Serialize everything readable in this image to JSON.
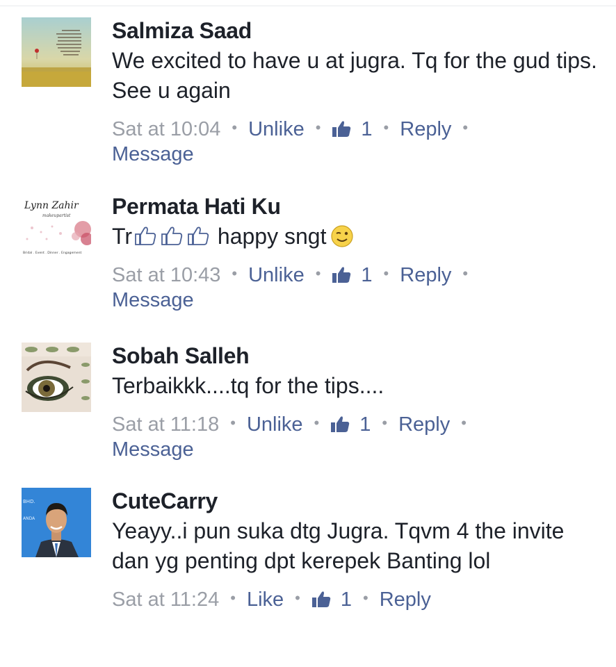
{
  "comments": [
    {
      "name": "Salmiza Saad",
      "text": "We excited to have u at jugra. Tq for the gud tips. See u again",
      "time": "Sat at 10:04",
      "like_action": "Unlike",
      "like_count": "1",
      "reply": "Reply",
      "message": "Message",
      "avatar_text": "...Kalau kita BERUBAH untuk jadi baik kerana Allah, Allah akan hantar orang-orang yang baik untuk bersama sama kita..."
    },
    {
      "name": "Permata Hati Ku",
      "text_prefix": "Tr",
      "text_suffix": "happy sngt",
      "time": "Sat at 10:43",
      "like_action": "Unlike",
      "like_count": "1",
      "reply": "Reply",
      "message": "Message",
      "avatar_title": "Lynn Zahir",
      "avatar_sub": "makeupartist",
      "avatar_caption": "Bridal . Event . Dinner . Engagement"
    },
    {
      "name": "Sobah Salleh",
      "text": "Terbaikkk....tq for the tips....",
      "time": "Sat at 11:18",
      "like_action": "Unlike",
      "like_count": "1",
      "reply": "Reply",
      "message": "Message"
    },
    {
      "name": "CuteCarry",
      "text": "Yeayy..i pun suka dtg Jugra. Tqvm 4 the invite dan yg penting dpt kerepek Banting lol",
      "time": "Sat at 11:24",
      "like_action": "Like",
      "like_count": "1",
      "reply": "Reply",
      "avatar_text_1": "BHD.",
      "avatar_text_2": "ANDA"
    }
  ],
  "separator": "•",
  "colors": {
    "name": "#1d2129",
    "link": "#4b6195",
    "muted": "#9a9ea6"
  }
}
